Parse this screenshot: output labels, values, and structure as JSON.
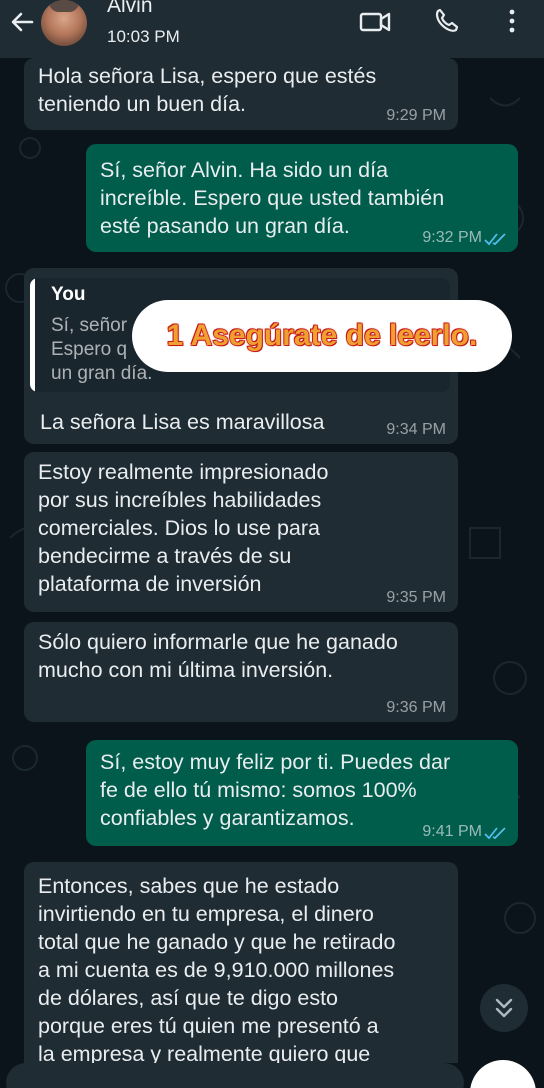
{
  "header": {
    "contact_name": "Alvin",
    "status": "10:03 PM",
    "icons": [
      "back-arrow-icon",
      "video-call-icon",
      "voice-call-icon",
      "more-options-icon"
    ]
  },
  "messages": [
    {
      "dir": "in",
      "text": "Hola señora Lisa, espero que estés\nteniendo un buen día.",
      "time": "9:29 PM"
    },
    {
      "dir": "out",
      "text": "Sí, señor Alvin. Ha sido un día\nincreíble. Espero que usted también\nesté pasando un gran día.",
      "time": "9:32 PM",
      "read": true
    },
    {
      "dir": "in",
      "quote_author": "You",
      "quote_text": "Sí, señor\nEspero q\nun gran día.",
      "text": "La señora Lisa es maravillosa",
      "time": "9:34 PM"
    },
    {
      "dir": "in",
      "text": "Estoy realmente impresionado\npor sus increíbles habilidades\ncomerciales. Dios lo use para\nbendecirme a través de su\nplataforma de inversión",
      "time": "9:35 PM"
    },
    {
      "dir": "in",
      "text": "Sólo quiero informarle que he ganado\nmucho con mi última inversión.",
      "time": "9:36 PM"
    },
    {
      "dir": "out",
      "text": "Sí, estoy muy feliz por ti. Puedes dar\nfe de ello tú mismo: somos 100%\nconfiables y garantizamos.",
      "time": "9:41 PM",
      "read": true
    },
    {
      "dir": "in",
      "text": "Entonces, sabes que he estado\ninvirtiendo en tu empresa, el dinero\ntotal que he ganado y que he retirado\na mi cuenta es de 9,910.000 millones\nde dólares, así que te digo esto\nporque eres tú quien me presentó a\nla empresa y realmente quiero que",
      "time": ""
    }
  ],
  "overlay": {
    "text": "1 Asegúrate de leerlo."
  },
  "colors": {
    "incoming": "#1f2c34",
    "outgoing": "#005c4b",
    "background": "#0b141a",
    "read_ticks": "#53bdeb"
  }
}
